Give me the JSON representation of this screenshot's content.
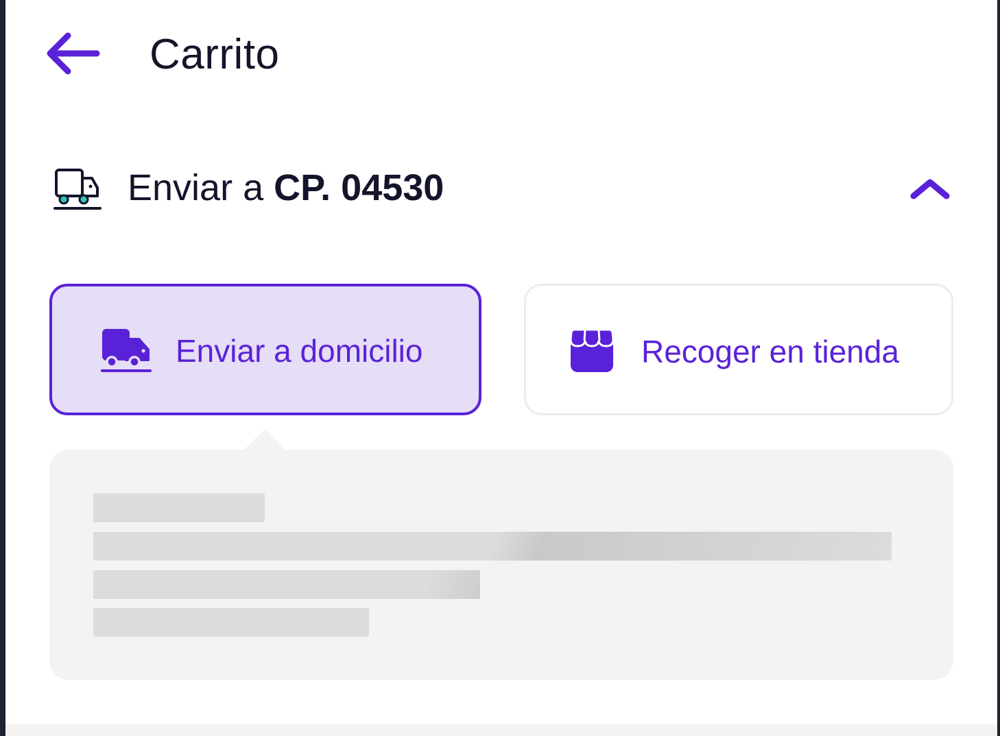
{
  "header": {
    "title": "Carrito",
    "back_icon": "arrow-left-icon"
  },
  "shipping": {
    "prefix": "Enviar a ",
    "postal_code": "CP. 04530",
    "icon": "truck-outline-icon",
    "toggle_icon": "chevron-up-icon"
  },
  "options": {
    "home": {
      "label": "Enviar a domicilio",
      "icon": "truck-icon",
      "selected": true
    },
    "store": {
      "label": "Recoger en tienda",
      "icon": "store-icon",
      "selected": false
    }
  },
  "colors": {
    "accent": "#5a22d8",
    "selected_bg": "#e6ddf6",
    "text": "#14142b",
    "panel_bg": "#f3f3f3",
    "skeleton": "#dcdcdc",
    "icon_wheel": "#2ec4b6"
  }
}
